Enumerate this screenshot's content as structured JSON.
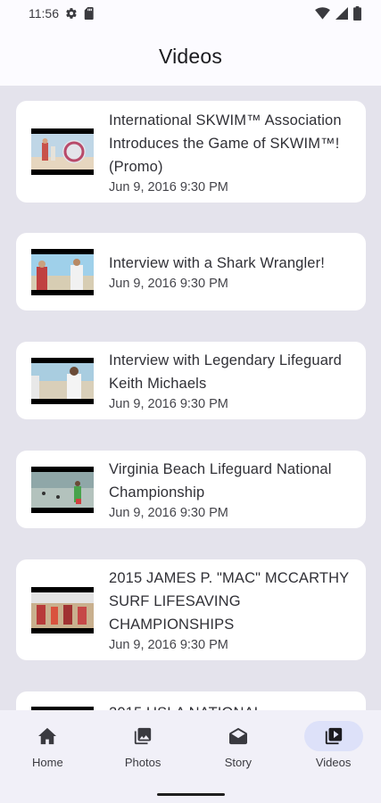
{
  "status_bar": {
    "time": "11:56"
  },
  "app_bar": {
    "title": "Videos"
  },
  "videos": [
    {
      "title": "International SKWIM™ Association Introduces the Game of SKWIM™! (Promo)",
      "date": "Jun 9, 2016 9:30 PM"
    },
    {
      "title": "Interview with a Shark Wrangler!",
      "date": "Jun 9, 2016 9:30 PM"
    },
    {
      "title": "Interview with Legendary Lifeguard Keith Michaels",
      "date": "Jun 9, 2016 9:30 PM"
    },
    {
      "title": "Virginia Beach Lifeguard National Championship",
      "date": "Jun 9, 2016 9:30 PM"
    },
    {
      "title": "2015 JAMES P. \"MAC\" MCCARTHY SURF LIFESAVING CHAMPIONSHIPS",
      "date": "Jun 9, 2016 9:30 PM"
    },
    {
      "title": "2015 USLA NATIONAL",
      "date": ""
    }
  ],
  "bottom_nav": [
    {
      "label": "Home",
      "icon": "home-icon",
      "active": false
    },
    {
      "label": "Photos",
      "icon": "photos-icon",
      "active": false
    },
    {
      "label": "Story",
      "icon": "story-icon",
      "active": false
    },
    {
      "label": "Videos",
      "icon": "videos-icon",
      "active": true
    }
  ]
}
